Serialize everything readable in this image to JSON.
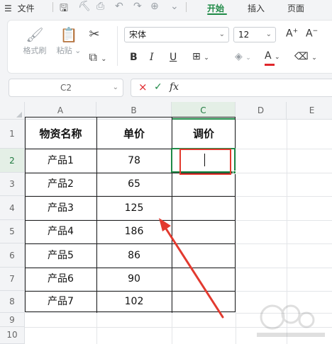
{
  "menubar": {
    "menu_icon": "☰",
    "file": "文件",
    "tabs": [
      "开始",
      "插入",
      "页面"
    ],
    "active_tab": "开始"
  },
  "ribbon": {
    "format_painter": "格式刷",
    "paste": "粘贴",
    "font_name": "宋体",
    "font_size": "12",
    "bold": "B",
    "italic": "I",
    "underline": "U",
    "font_color_glyph": "A",
    "font_color": "#e0262b"
  },
  "formula_bar": {
    "name_box": "C2",
    "cancel": "×",
    "confirm": "✓",
    "fx": "fx"
  },
  "sheet": {
    "columns": [
      "A",
      "B",
      "C",
      "D",
      "E"
    ],
    "rows": [
      "1",
      "2",
      "3",
      "4",
      "5",
      "6",
      "7",
      "8",
      "9",
      "10"
    ],
    "headers": {
      "a": "物资名称",
      "b": "单价",
      "c": "调价"
    },
    "items": [
      {
        "name": "产品1",
        "price": "78"
      },
      {
        "name": "产品2",
        "price": "65"
      },
      {
        "name": "产品3",
        "price": "125"
      },
      {
        "name": "产品4",
        "price": "186"
      },
      {
        "name": "产品5",
        "price": "86"
      },
      {
        "name": "产品6",
        "price": "90"
      },
      {
        "name": "产品7",
        "price": "102"
      }
    ],
    "active_cell": "C2"
  },
  "colors": {
    "accent": "#1f8a47",
    "annotation": "#e23a2f"
  }
}
